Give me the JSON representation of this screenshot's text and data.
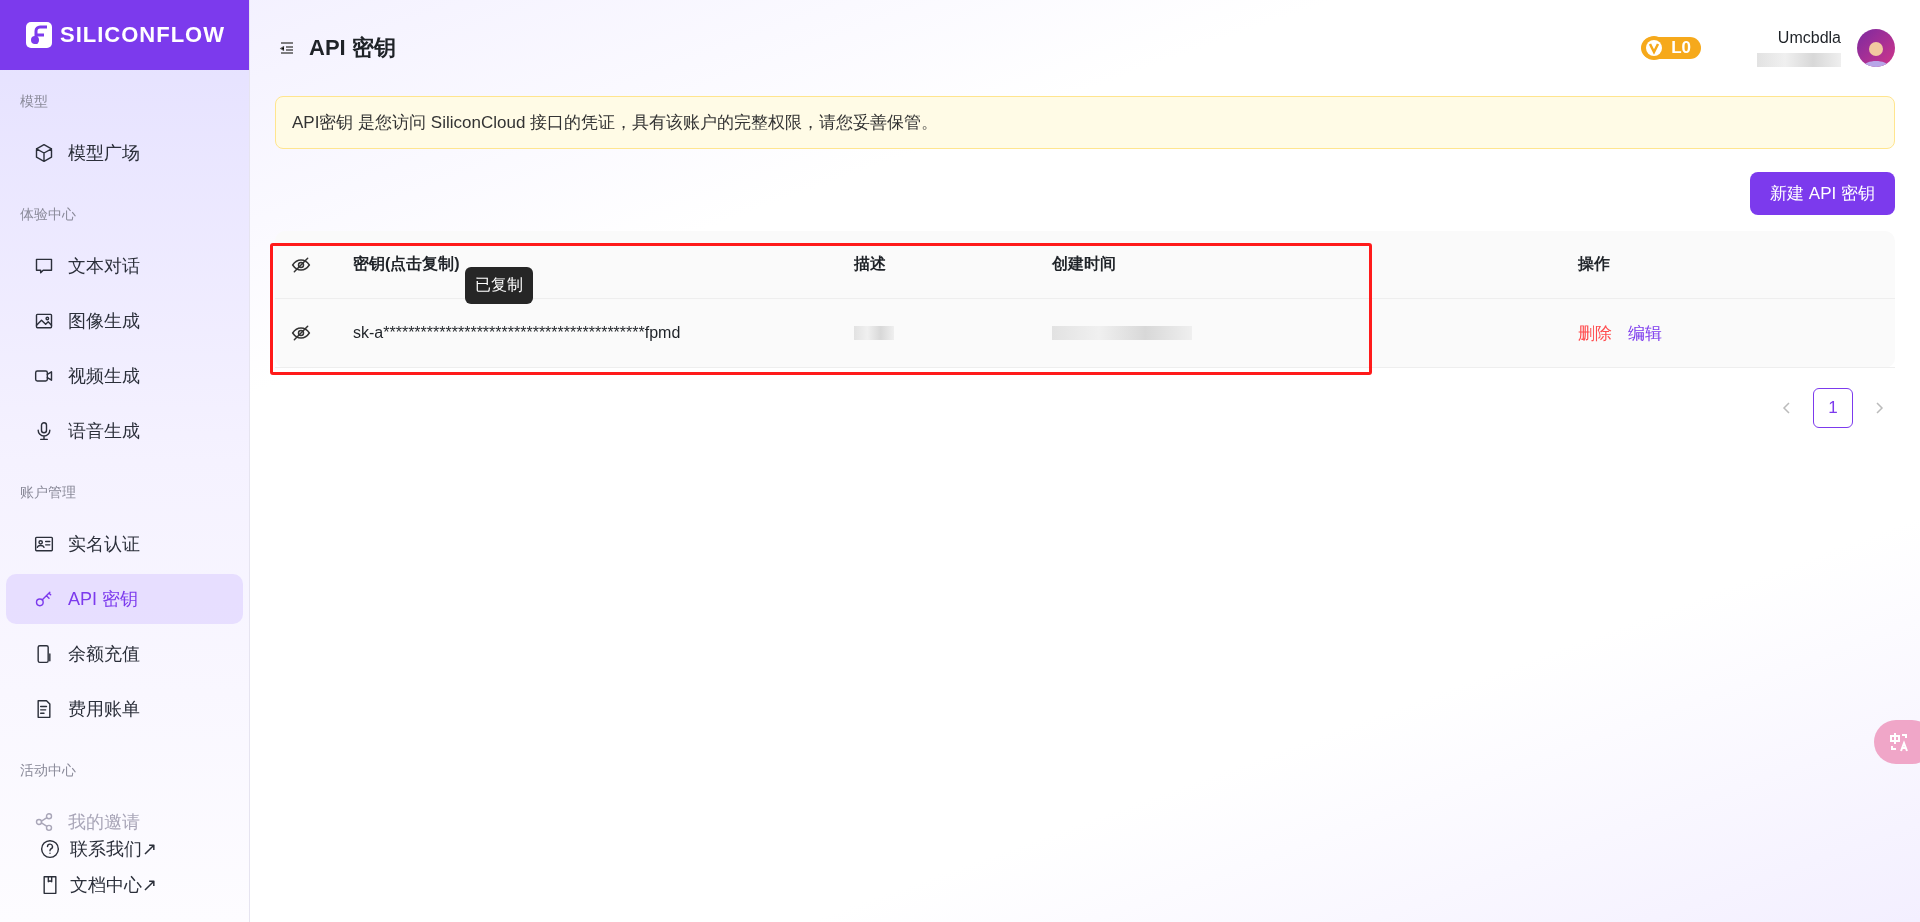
{
  "brand": {
    "name": "SILICONFLOW"
  },
  "sidebar": {
    "sections": [
      {
        "title": "模型",
        "items": [
          {
            "label": "模型广场",
            "selected": false
          }
        ]
      },
      {
        "title": "体验中心",
        "items": [
          {
            "label": "文本对话",
            "selected": false
          },
          {
            "label": "图像生成",
            "selected": false
          },
          {
            "label": "视频生成",
            "selected": false
          },
          {
            "label": "语音生成",
            "selected": false
          }
        ]
      },
      {
        "title": "账户管理",
        "items": [
          {
            "label": "实名认证",
            "selected": false
          },
          {
            "label": "API 密钥",
            "selected": true
          },
          {
            "label": "余额充值",
            "selected": false
          },
          {
            "label": "费用账单",
            "selected": false
          }
        ]
      },
      {
        "title": "活动中心",
        "items": [
          {
            "label": "我的邀请",
            "selected": false,
            "disabled": true
          }
        ]
      }
    ],
    "footer": [
      {
        "label": "联系我们",
        "arrow": "↗"
      },
      {
        "label": "文档中心",
        "arrow": "↗"
      }
    ]
  },
  "header": {
    "title": "API 密钥",
    "level_badge": "L0",
    "user": {
      "name": "Umcbdla"
    }
  },
  "notice": "API密钥 是您访问 SiliconCloud 接口的凭证，具有该账户的完整权限，请您妥善保管。",
  "new_key_button": "新建 API 密钥",
  "table": {
    "columns": [
      "密钥(点击复制)",
      "描述",
      "创建时间",
      "操作"
    ],
    "rows": [
      {
        "key": "sk-a******************************************fpmd",
        "actions": [
          {
            "label": "删除",
            "kind": "danger"
          },
          {
            "label": "编辑",
            "kind": "primary"
          }
        ]
      }
    ]
  },
  "tooltip": "已复制",
  "pagination": {
    "pages": [
      {
        "label": "1",
        "selected": true
      }
    ]
  }
}
